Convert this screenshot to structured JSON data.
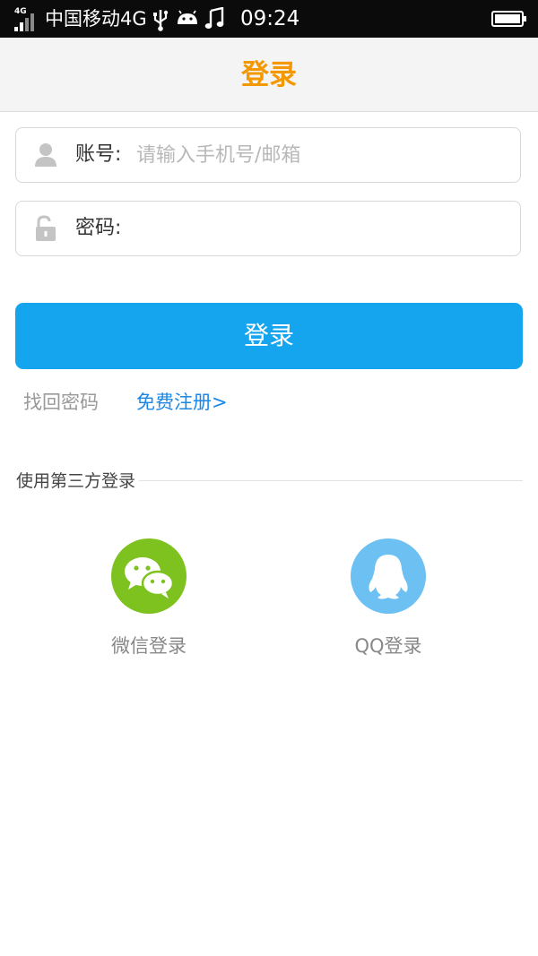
{
  "status_bar": {
    "network_badge": "4G",
    "carrier": "中国移动4G",
    "time": "09:24",
    "icons": [
      "signal-icon",
      "usb-icon",
      "android-icon",
      "music-icon",
      "battery-icon"
    ]
  },
  "header": {
    "title": "登录",
    "title_color": "#f39800"
  },
  "form": {
    "account_label": "账号:",
    "account_placeholder": "请输入手机号/邮箱",
    "account_value": "",
    "password_label": "密码:",
    "password_value": ""
  },
  "actions": {
    "login_label": "登录",
    "login_color": "#15a5ef",
    "forgot_label": "找回密码",
    "register_label": "免费注册>"
  },
  "third_party": {
    "section_label": "使用第三方登录",
    "wechat_label": "微信登录",
    "qq_label": "QQ登录",
    "wechat_color": "#7dc21e",
    "qq_color": "#6cc0f2"
  }
}
